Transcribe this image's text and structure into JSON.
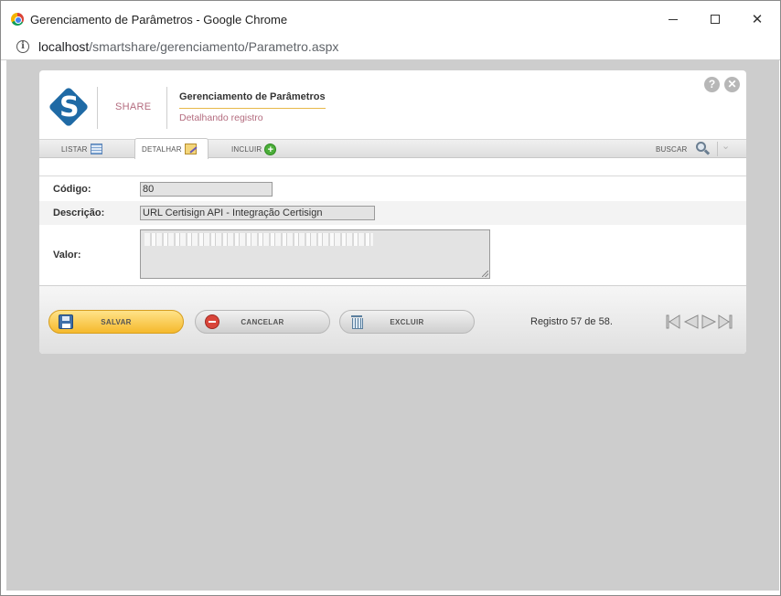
{
  "window": {
    "title": "Gerenciamento de Parâmetros - Google Chrome"
  },
  "address": {
    "host": "localhost",
    "path": "/smartshare/gerenciamento/Parametro.aspx"
  },
  "header": {
    "brand": "SHARE",
    "title": "Gerenciamento de Parâmetros",
    "subtitle": "Detalhando registro",
    "help_label": "?",
    "close_label": "✕"
  },
  "tabs": {
    "listar": "LISTAR",
    "detalhar": "DETALHAR",
    "incluir": "INCLUIR",
    "buscar": "BUSCAR"
  },
  "form": {
    "codigo_label": "Código:",
    "codigo_value": "80",
    "descricao_label": "Descrição:",
    "descricao_value": "URL Certisign API - Integração Certisign",
    "valor_label": "Valor:"
  },
  "actions": {
    "salvar": "SALVAR",
    "cancelar": "CANCELAR",
    "excluir": "EXCLUIR"
  },
  "pagination": {
    "status": "Registro 57 de 58."
  },
  "colors": {
    "accent": "#f5b92c",
    "brand": "#1f6aa5",
    "subtitle": "#b36b7e",
    "background": "#cdcdcd"
  }
}
